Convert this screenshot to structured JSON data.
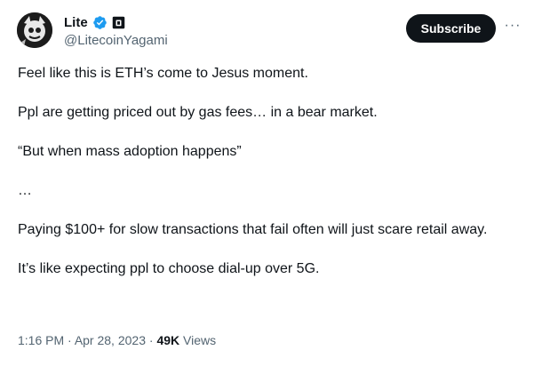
{
  "author": {
    "display_name": "Lite",
    "handle": "@LitecoinYagami",
    "verified_icon": "verified-badge-icon",
    "affiliate_icon": "affiliate-badge-icon",
    "avatar_icon": "avatar-image"
  },
  "actions": {
    "subscribe_label": "Subscribe",
    "more_label": "···"
  },
  "tweet": {
    "paragraphs": [
      "Feel like this is ETH’s come to Jesus moment.",
      "Ppl are getting priced out by gas fees… in a bear market.",
      "“But when mass adoption happens”",
      "…",
      "Paying $100+ for slow transactions that fail often will just scare retail away.",
      "It’s like expecting ppl to choose dial-up over 5G."
    ]
  },
  "meta": {
    "time": "1:16 PM",
    "separator": " · ",
    "date": "Apr 28, 2023",
    "views_count": "49K",
    "views_label": " Views"
  },
  "colors": {
    "text": "#0f1419",
    "secondary": "#536471",
    "verified": "#1d9bf0",
    "button_bg": "#0f1419"
  }
}
